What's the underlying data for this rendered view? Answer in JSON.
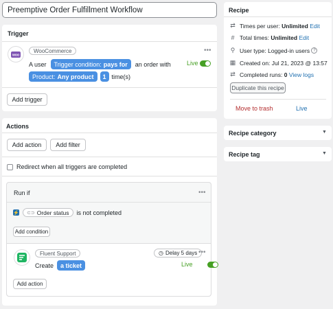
{
  "title_input": {
    "value": "Preemptive Order Fulfillment Workflow"
  },
  "trigger": {
    "heading": "Trigger",
    "integration_tag": "WooCommerce",
    "sentence": {
      "prefix": "A user",
      "condition_label": "Trigger condition:",
      "condition_value": "pays for",
      "middle": "an order with",
      "product_label": "Product:",
      "product_value": "Any product",
      "count": "1",
      "suffix": "time(s)"
    },
    "status": "Live",
    "add_button": "Add trigger",
    "more": "•••"
  },
  "actions": {
    "heading": "Actions",
    "add_action_label": "Add action",
    "add_filter_label": "Add filter",
    "redirect_label": "Redirect when all triggers are completed",
    "run_if": {
      "heading": "Run if",
      "condition_field": "Order status",
      "condition_text": "is not completed",
      "add_condition_label": "Add condition",
      "more": "•••"
    },
    "action_item": {
      "integration_tag": "Fluent Support",
      "delay_label": "Delay 5 days",
      "verb": "Create",
      "object": "a ticket",
      "status": "Live",
      "more": "•••"
    },
    "inner_add_action_label": "Add action"
  },
  "recipe": {
    "heading": "Recipe",
    "rows": [
      {
        "icon": "repeat-icon",
        "label": "Times per user:",
        "value": "Unlimited",
        "link": "Edit"
      },
      {
        "icon": "hash-icon",
        "label": "Total times:",
        "value": "Unlimited",
        "link": "Edit"
      },
      {
        "icon": "user-icon",
        "label": "User type:",
        "value": "Logged-in users",
        "link": ""
      },
      {
        "icon": "calendar-icon",
        "label": "Created on:",
        "value": "Jul 21, 2023 @ 13:57",
        "link": ""
      },
      {
        "icon": "repeat-icon",
        "label": "Completed runs:",
        "value": "0",
        "link": "View logs"
      }
    ],
    "duplicate_label": "Duplicate this recipe",
    "trash_label": "Move to trash",
    "status": "Live"
  },
  "recipe_category": {
    "heading": "Recipe category"
  },
  "recipe_tag": {
    "heading": "Recipe tag"
  },
  "colors": {
    "accent": "#4a90e2",
    "live_green": "#46a024",
    "trash_red": "#b32d2e",
    "toggle_green": "#46a024",
    "toggle_blue": "#2271b1"
  }
}
